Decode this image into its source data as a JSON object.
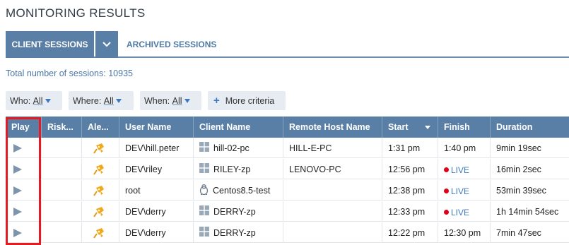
{
  "page": {
    "title": "MONITORING RESULTS"
  },
  "tabs": {
    "active": "CLIENT SESSIONS",
    "inactive": "ARCHIVED SESSIONS"
  },
  "summary": {
    "total_text": "Total number of sessions: 10935"
  },
  "filters": [
    {
      "label": "Who: ",
      "value": "All"
    },
    {
      "label": "Where: ",
      "value": "All"
    },
    {
      "label": "When: ",
      "value": "All"
    },
    {
      "label": "More criteria"
    }
  ],
  "table": {
    "columns": [
      "Play",
      "Risk...",
      "Ale...",
      "User Name",
      "Client Name",
      "Remote Host Name",
      "Start",
      "Finish",
      "Duration"
    ],
    "sorted_column": "Start",
    "rows": [
      {
        "user": "DEV\\hill.peter",
        "client": "hill-02-pc",
        "client_os": "windows",
        "remote_host": "HILL-E-PC",
        "start": "1:31 pm",
        "finish": "1:40 pm",
        "live": false,
        "duration": "9min 19sec"
      },
      {
        "user": "DEV\\riley",
        "client": "RILEY-zp",
        "client_os": "windows",
        "remote_host": "LENOVO-PC",
        "start": "12:56 pm",
        "finish": "LIVE",
        "live": true,
        "duration": "16min 2sec"
      },
      {
        "user": "root",
        "client": "Centos8.5-test",
        "client_os": "linux",
        "remote_host": "",
        "start": "12:38 pm",
        "finish": "LIVE",
        "live": true,
        "duration": "53min 39sec"
      },
      {
        "user": "DEV\\derry",
        "client": "DERRY-zp",
        "client_os": "windows",
        "remote_host": "",
        "start": "12:33 pm",
        "finish": "LIVE",
        "live": true,
        "duration": "1h 14min 54sec"
      },
      {
        "user": "DEV\\derry",
        "client": "DERRY-zp",
        "client_os": "windows",
        "remote_host": "",
        "start": "12:22 pm",
        "finish": "12:30 pm",
        "live": false,
        "duration": "7min 47sec"
      }
    ]
  },
  "colors": {
    "header_bg": "#5a7fa6",
    "link_blue": "#4f79a3",
    "live_dot": "#e0001b",
    "highlight_border": "#e31b23",
    "alert_icon": "#f0a818"
  },
  "icons": {
    "tab_dropdown": "chevron-down-icon",
    "filter_caret": "caret-down-icon",
    "more_criteria": "plus-icon",
    "play": "play-icon",
    "alert": "alert-flag-icon",
    "windows": "windows-icon",
    "linux": "linux-icon",
    "live": "live-dot-icon",
    "sort": "sort-desc-icon"
  }
}
